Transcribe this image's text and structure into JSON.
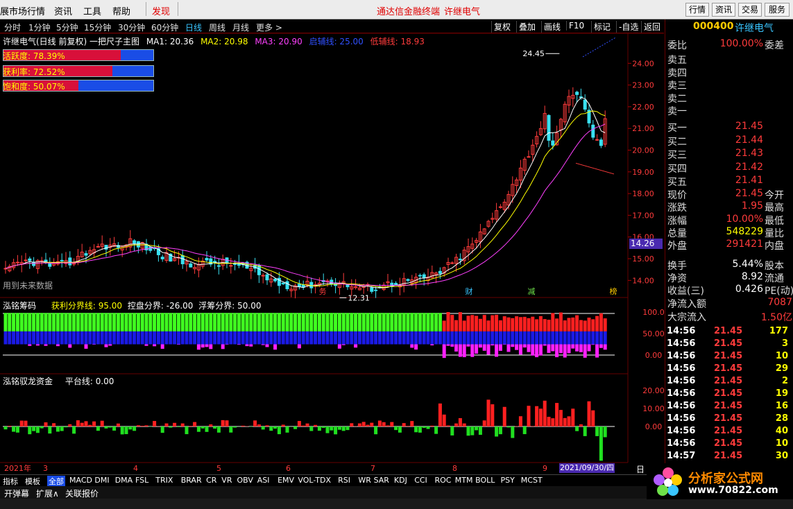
{
  "topbar": {
    "menus": [
      "展市场行情",
      "资讯",
      "工具",
      "帮助"
    ],
    "discover": "发现",
    "center_links": [
      "通达信金融终端",
      "许继电气"
    ],
    "right_buttons": [
      "行情",
      "资讯",
      "交易",
      "服务"
    ]
  },
  "toolbar": {
    "periods": [
      "分时",
      "1分钟",
      "5分钟",
      "15分钟",
      "30分钟",
      "60分钟",
      "日线",
      "周线",
      "月线",
      "更多 >"
    ],
    "active_period": "日线",
    "right_buttons": [
      "复权",
      "叠加",
      "画线",
      "F10",
      "标记",
      "-自选",
      "返回"
    ]
  },
  "price_header": {
    "title": "许继电气(日线 前复权) 一把尺子主图",
    "ma1": "MA1: 20.36",
    "ma2": "MA2: 20.98",
    "ma3": "MA3: 20.90",
    "ref1": "启辅线: 25.00",
    "ref2": "低辅线: 18.93"
  },
  "gauges": [
    {
      "label": "活跃度: 78.39%",
      "fraction": 0.7839
    },
    {
      "label": "获利率: 72.52%",
      "fraction": 0.7252
    },
    {
      "label": "饱和度: 50.07%",
      "fraction": 0.5007
    }
  ],
  "price_chart": {
    "y_ticks": [
      "24.00",
      "23.00",
      "22.00",
      "21.00",
      "20.00",
      "19.00",
      "18.00",
      "17.00",
      "16.00",
      "15.00",
      "14.00"
    ],
    "y_min": 13.5,
    "y_max": 25.0,
    "high_label": "24.45",
    "low_label": "12.31",
    "crosshair_value": "14.26",
    "future_note": "用到未来数据",
    "markers": [
      "务",
      "财",
      "减",
      "榜"
    ]
  },
  "chip_panel": {
    "title": "泓铭筹码",
    "line1": "获利分界线: 95.00",
    "line2": "控盘分界: -26.00",
    "line3": "浮筹分界: 50.00",
    "y_ticks": [
      "100.0",
      "50.00",
      "0.00"
    ]
  },
  "fund_panel": {
    "title": "泓铭驭龙资金",
    "line1": "平台线: 0.00",
    "y_ticks": [
      "20.00",
      "10.00",
      "0.00"
    ]
  },
  "x_axis": {
    "labels": [
      "2021年",
      "3",
      "4",
      "5",
      "6",
      "7",
      "8",
      "9"
    ],
    "cursor_date": "2021/09/30/四"
  },
  "quote": {
    "code": "000400",
    "name": "许继电气",
    "weibi_label": "委比",
    "weibi_value": "100.00%",
    "weicha_label": "委差",
    "asks": [
      "卖五",
      "卖四",
      "卖三",
      "卖二",
      "卖一"
    ],
    "bids": [
      {
        "label": "买一",
        "price": "21.45"
      },
      {
        "label": "买二",
        "price": "21.44"
      },
      {
        "label": "买三",
        "price": "21.43"
      },
      {
        "label": "买四",
        "price": "21.42"
      },
      {
        "label": "买五",
        "price": "21.41"
      }
    ],
    "stats": [
      {
        "k": "现价",
        "v": "21.45",
        "k2": "今开",
        "color": "red"
      },
      {
        "k": "涨跌",
        "v": "1.95",
        "k2": "最高",
        "color": "red"
      },
      {
        "k": "涨幅",
        "v": "10.00%",
        "k2": "最低",
        "color": "red"
      },
      {
        "k": "总量",
        "v": "548229",
        "k2": "量比",
        "color": "yel"
      },
      {
        "k": "外盘",
        "v": "291421",
        "k2": "内盘",
        "color": "red"
      },
      {
        "k": "换手",
        "v": "5.44%",
        "k2": "股本",
        "color": "white"
      },
      {
        "k": "净资",
        "v": "8.92",
        "k2": "流通",
        "color": "white"
      },
      {
        "k": "收益(三)",
        "v": "0.426",
        "k2": "PE(动)",
        "color": "white"
      }
    ],
    "inflow": [
      {
        "k": "净流入额",
        "v": "7087"
      },
      {
        "k": "大宗流入",
        "v": "1.50亿"
      }
    ],
    "ticks": [
      {
        "t": "14:56",
        "p": "21.45",
        "q": "177"
      },
      {
        "t": "14:56",
        "p": "21.45",
        "q": "3"
      },
      {
        "t": "14:56",
        "p": "21.45",
        "q": "10"
      },
      {
        "t": "14:56",
        "p": "21.45",
        "q": "29"
      },
      {
        "t": "14:56",
        "p": "21.45",
        "q": "2"
      },
      {
        "t": "14:56",
        "p": "21.45",
        "q": "19"
      },
      {
        "t": "14:56",
        "p": "21.45",
        "q": "16"
      },
      {
        "t": "14:56",
        "p": "21.45",
        "q": "28"
      },
      {
        "t": "14:56",
        "p": "21.45",
        "q": "40"
      },
      {
        "t": "14:56",
        "p": "21.45",
        "q": "10"
      },
      {
        "t": "14:57",
        "p": "21.45",
        "q": "30"
      }
    ]
  },
  "tabs": [
    "指标",
    "模板",
    "全部",
    "MACD",
    "DMI",
    "DMA",
    "FSL",
    "TRIX",
    "BRAR",
    "CR",
    "VR",
    "OBV",
    "ASI",
    "EMV",
    "VOL-TDX",
    "RSI",
    "WR",
    "SAR",
    "KDJ",
    "CCI",
    "ROC",
    "MTM",
    "BOLL",
    "PSY",
    "MCST"
  ],
  "active_tab": "全部",
  "bottom_buttons": [
    "开弹幕",
    "扩展∧",
    "关联报价"
  ],
  "day_label": "日",
  "logo": {
    "text": "分析家公式网",
    "url": "www.70822.com"
  },
  "colors": {
    "up": "#ff3b3b",
    "down": "#39e0f0",
    "ma1": "#ffffff",
    "ma2": "#ffff00",
    "ma3": "#ff40ff",
    "accent": "#39c5ff"
  }
}
